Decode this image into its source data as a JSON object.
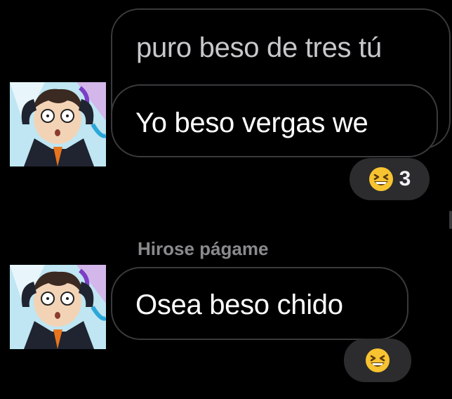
{
  "messages": {
    "quoted": {
      "text": "puro beso de tres tú"
    },
    "first": {
      "text": "Yo beso vergas we",
      "reaction": {
        "emoji": "grinning-squinting-face",
        "count": "3"
      }
    },
    "second": {
      "sender": "Hirose págame",
      "text": "Osea beso chido",
      "reaction": {
        "emoji": "grinning-squinting-face"
      }
    }
  },
  "colors": {
    "background": "#000000",
    "bubble_border": "#3a3a3c",
    "reaction_chip": "#2c2c2e",
    "sender_name": "#8a8a8e",
    "emoji_yellow": "#f7c331"
  }
}
